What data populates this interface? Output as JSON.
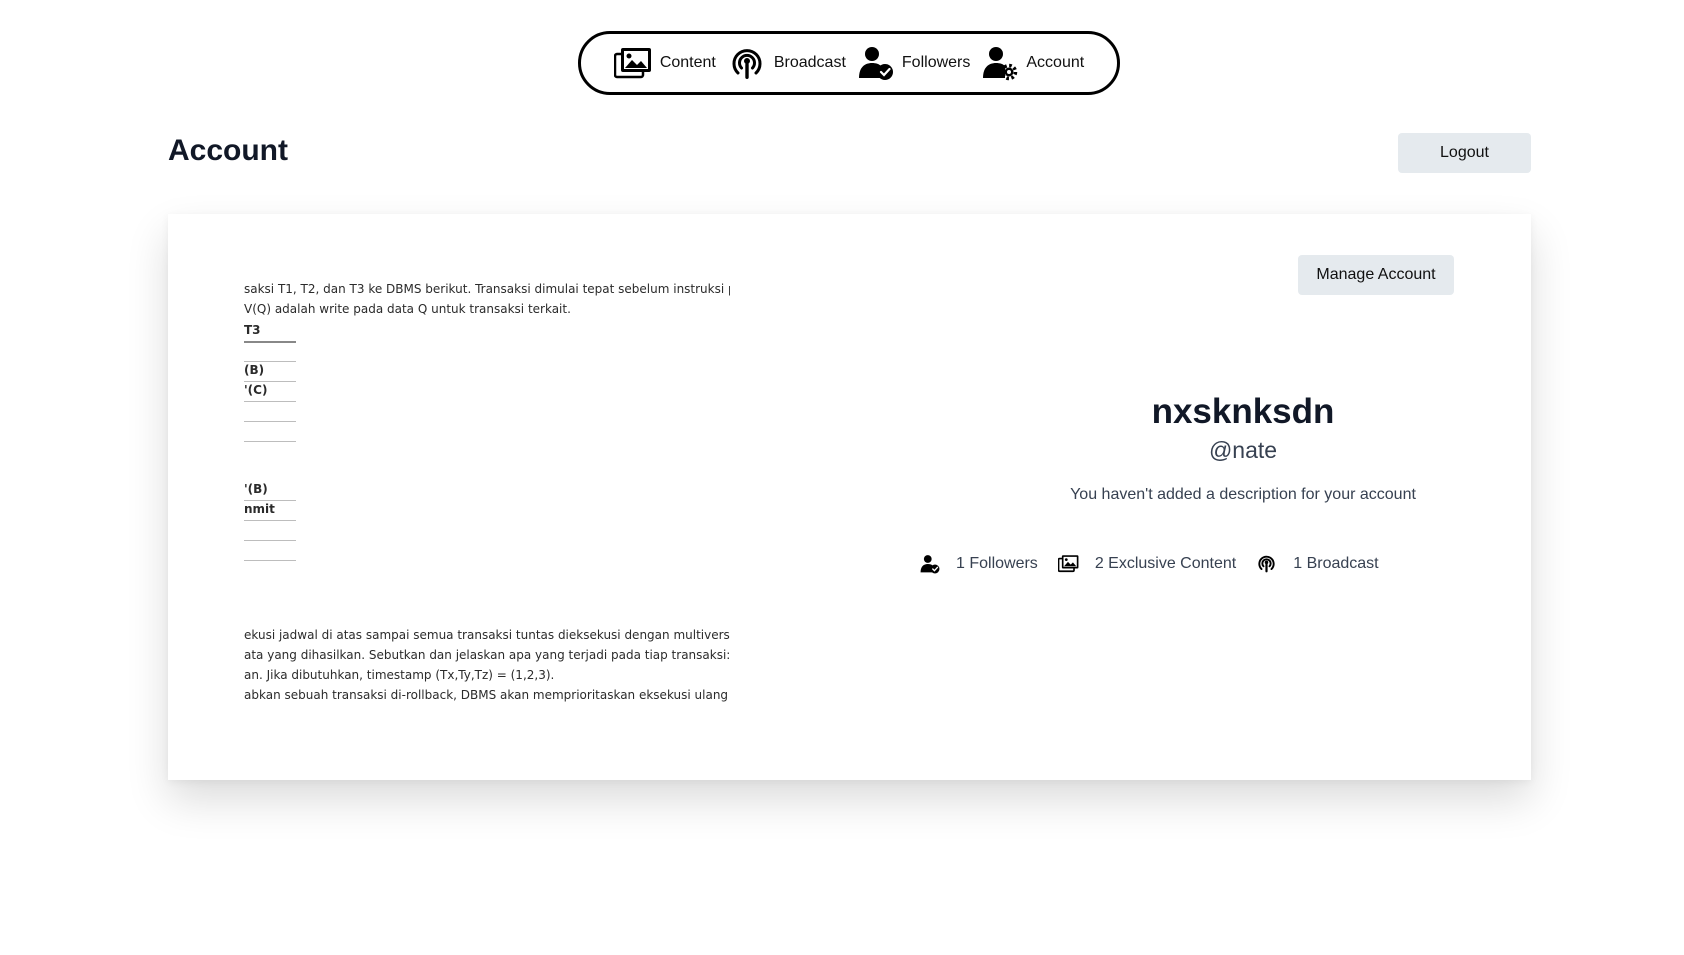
{
  "nav": {
    "items": [
      {
        "label": "Content",
        "icon": "images-icon"
      },
      {
        "label": "Broadcast",
        "icon": "broadcast-icon"
      },
      {
        "label": "Followers",
        "icon": "user-check-icon"
      },
      {
        "label": "Account",
        "icon": "user-gear-icon"
      }
    ]
  },
  "page": {
    "title": "Account",
    "logout_label": "Logout"
  },
  "card": {
    "manage_label": "Manage Account",
    "banner": {
      "lines_top": [
        "saksi T1, T2, dan T3 ke DBMS berikut. Transaksi dimulai tepat sebelum instruksi pe",
        "V(Q) adalah write pada data Q untuk transaksi terkait."
      ],
      "table_cells": [
        "T3",
        "",
        "(B)",
        "'(C)",
        "",
        "",
        "'(B)",
        "nmit",
        "",
        ""
      ],
      "lines_bottom": [
        "ekusi jadwal di atas sampai semua transaksi tuntas dieksekusi dengan multiversio",
        "ata yang dihasilkan. Sebutkan dan jelaskan apa yang terjadi pada tiap transaksi: a",
        "an. Jika dibutuhkan, timestamp (Tx,Ty,Tz) = (1,2,3).",
        "abkan sebuah transaksi di-rollback, DBMS akan memprioritaskan eksekusi ulang d"
      ]
    },
    "profile": {
      "display_name": "nxsknksdn",
      "username": "@nate",
      "description": "You haven't added a description for your account"
    },
    "stats": [
      {
        "icon": "user-check-icon",
        "label": "1 Followers"
      },
      {
        "icon": "images-icon",
        "label": "2 Exclusive Content"
      },
      {
        "icon": "broadcast-icon",
        "label": "1 Broadcast"
      }
    ]
  }
}
